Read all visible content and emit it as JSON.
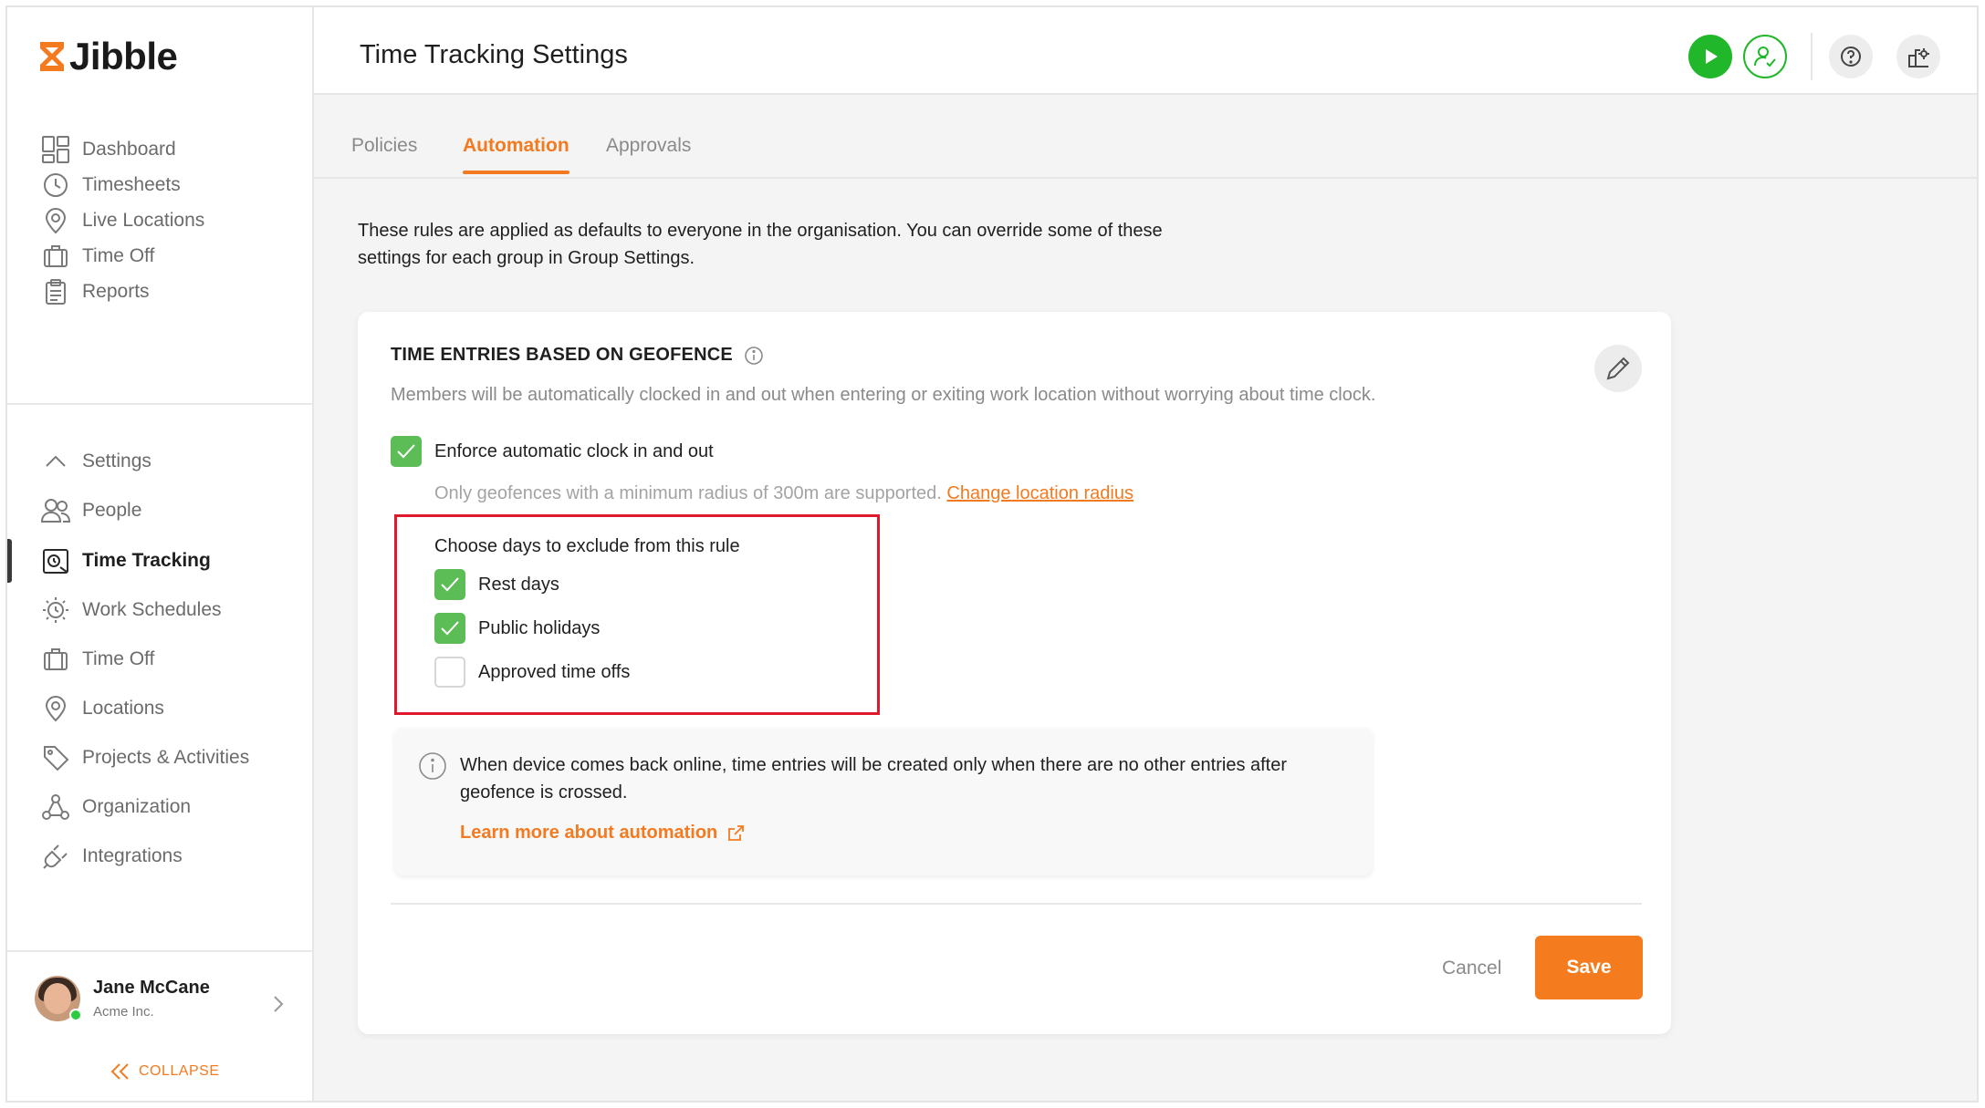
{
  "app": {
    "name": "Jibble"
  },
  "sidebar": {
    "main_items": [
      {
        "label": "Dashboard",
        "icon": "dashboard-icon"
      },
      {
        "label": "Timesheets",
        "icon": "clock-icon"
      },
      {
        "label": "Live Locations",
        "icon": "location-pin-icon"
      },
      {
        "label": "Time Off",
        "icon": "luggage-icon"
      },
      {
        "label": "Reports",
        "icon": "clipboard-icon"
      }
    ],
    "settings_items": [
      {
        "label": "Settings",
        "icon": "chevron-up-icon"
      },
      {
        "label": "People",
        "icon": "people-icon"
      },
      {
        "label": "Time Tracking",
        "icon": "time-tracking-icon",
        "active": true
      },
      {
        "label": "Work Schedules",
        "icon": "work-schedule-icon"
      },
      {
        "label": "Time Off",
        "icon": "luggage-icon"
      },
      {
        "label": "Locations",
        "icon": "location-pin-icon"
      },
      {
        "label": "Projects & Activities",
        "icon": "tag-icon"
      },
      {
        "label": "Organization",
        "icon": "org-chart-icon"
      },
      {
        "label": "Integrations",
        "icon": "plug-icon"
      }
    ],
    "user": {
      "name": "Jane McCane",
      "org": "Acme Inc.",
      "status": "online"
    },
    "collapse_label": "COLLAPSE"
  },
  "header": {
    "title": "Time Tracking Settings"
  },
  "tabs": [
    {
      "label": "Policies",
      "active": false
    },
    {
      "label": "Automation",
      "active": true
    },
    {
      "label": "Approvals",
      "active": false
    }
  ],
  "intro": {
    "line1": "These rules are applied as defaults to everyone in the organisation. You can override some of these",
    "line2": "settings for each group in Group Settings."
  },
  "card": {
    "title": "TIME ENTRIES BASED ON GEOFENCE",
    "description": "Members will be automatically clocked in and out when entering or exiting work location without worrying about time clock.",
    "enforce": {
      "label": "Enforce automatic clock in and out",
      "checked": true
    },
    "radius_note": "Only geofences with a minimum radius of 300m are supported.",
    "radius_link": "Change location radius",
    "exclude_title": "Choose days to exclude from this rule",
    "exclude_options": [
      {
        "label": "Rest days",
        "checked": true
      },
      {
        "label": "Public holidays",
        "checked": true
      },
      {
        "label": "Approved time offs",
        "checked": false
      }
    ],
    "info": {
      "line1": "When device comes back online, time entries will be created only when there are no other entries after",
      "line2": "geofence is crossed.",
      "link": "Learn more about automation"
    },
    "cancel_label": "Cancel",
    "save_label": "Save"
  },
  "colors": {
    "accent": "#f47a20",
    "check": "#5cbd57",
    "play": "#20b82a",
    "highlight": "#e0182b"
  }
}
